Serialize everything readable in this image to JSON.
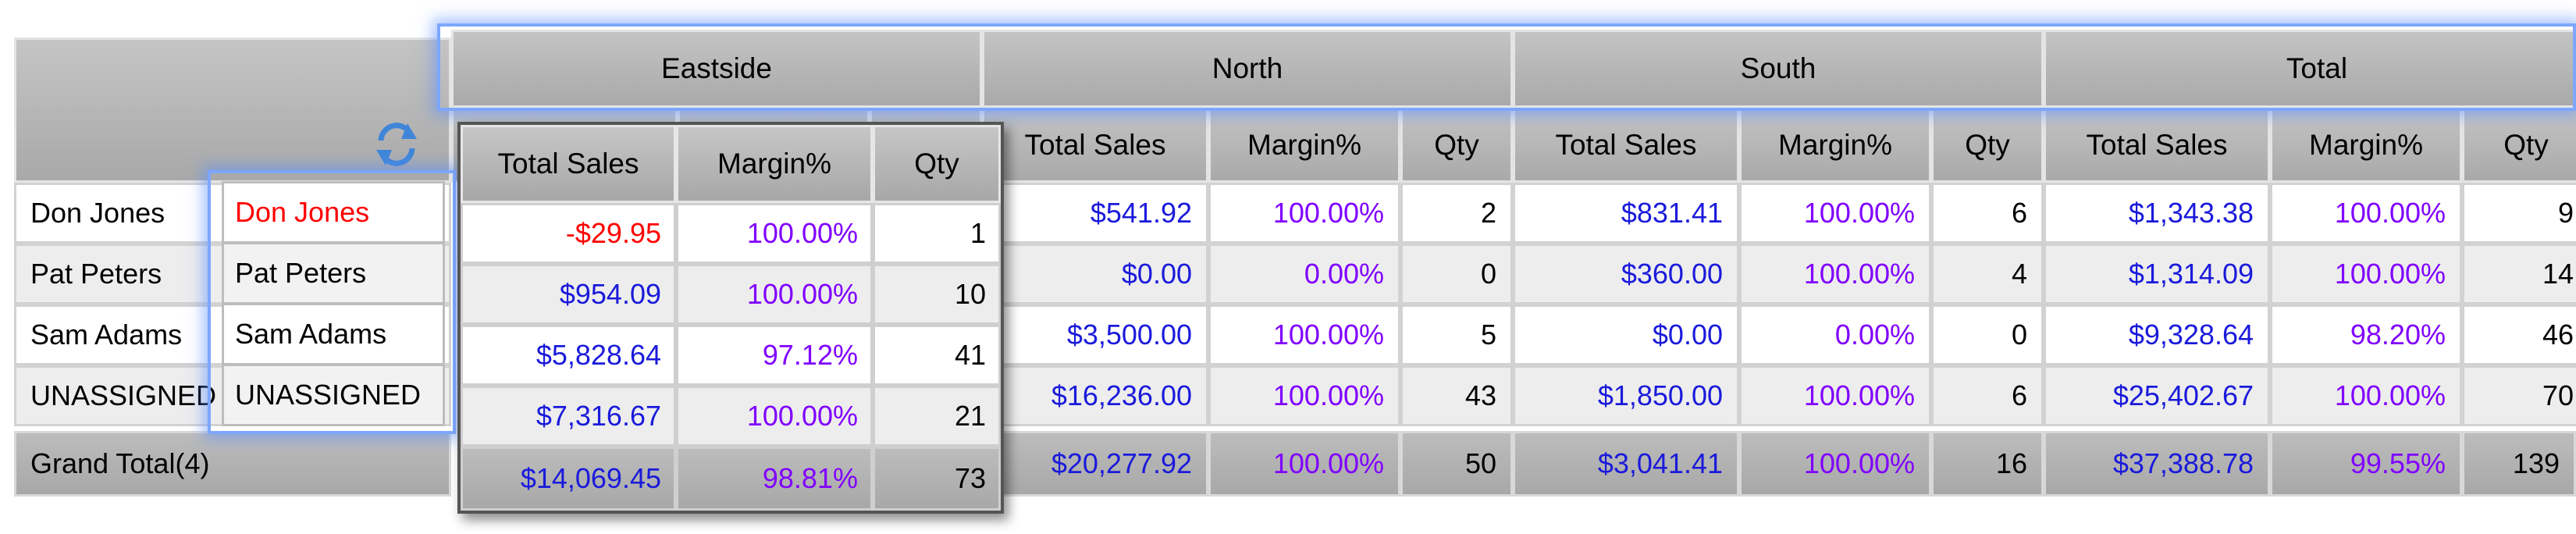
{
  "regions": [
    "Eastside",
    "North",
    "South",
    "Total"
  ],
  "measures": [
    "Total Sales",
    "Margin%",
    "Qty"
  ],
  "rows": [
    {
      "name": "Don Jones",
      "north": {
        "sales": "$541.92",
        "margin": "100.00%",
        "qty": "2"
      },
      "south": {
        "sales": "$831.41",
        "margin": "100.00%",
        "qty": "6"
      },
      "total": {
        "sales": "$1,343.38",
        "margin": "100.00%",
        "qty": "9"
      }
    },
    {
      "name": "Pat Peters",
      "north": {
        "sales": "$0.00",
        "margin": "0.00%",
        "qty": "0"
      },
      "south": {
        "sales": "$360.00",
        "margin": "100.00%",
        "qty": "4"
      },
      "total": {
        "sales": "$1,314.09",
        "margin": "100.00%",
        "qty": "14"
      }
    },
    {
      "name": "Sam Adams",
      "north": {
        "sales": "$3,500.00",
        "margin": "100.00%",
        "qty": "5"
      },
      "south": {
        "sales": "$0.00",
        "margin": "0.00%",
        "qty": "0"
      },
      "total": {
        "sales": "$9,328.64",
        "margin": "98.20%",
        "qty": "46"
      }
    },
    {
      "name": "UNASSIGNED",
      "north": {
        "sales": "$16,236.00",
        "margin": "100.00%",
        "qty": "43"
      },
      "south": {
        "sales": "$1,850.00",
        "margin": "100.00%",
        "qty": "6"
      },
      "total": {
        "sales": "$25,402.67",
        "margin": "100.00%",
        "qty": "70"
      }
    }
  ],
  "grand_total": {
    "label": "Grand Total(4)",
    "north": {
      "sales": "$20,277.92",
      "margin": "100.00%",
      "qty": "50"
    },
    "south": {
      "sales": "$3,041.41",
      "margin": "100.00%",
      "qty": "16"
    },
    "total": {
      "sales": "$37,388.78",
      "margin": "99.55%",
      "qty": "139"
    }
  },
  "eastside_popup": {
    "headers": [
      "Total Sales",
      "Margin%",
      "Qty"
    ],
    "rows": [
      {
        "sales": "-$29.95",
        "margin": "100.00%",
        "qty": "1"
      },
      {
        "sales": "$954.09",
        "margin": "100.00%",
        "qty": "10"
      },
      {
        "sales": "$5,828.64",
        "margin": "97.12%",
        "qty": "41"
      },
      {
        "sales": "$7,316.67",
        "margin": "100.00%",
        "qty": "21"
      },
      {
        "sales": "$14,069.45",
        "margin": "98.81%",
        "qty": "73"
      }
    ]
  },
  "drag_column": [
    "Don Jones",
    "Pat Peters",
    "Sam Adams",
    "UNASSIGNED"
  ],
  "colors": {
    "blue": "#1a1adb",
    "purple": "#8000ff",
    "red": "#ff0000",
    "highlight": "#7da7ff"
  },
  "icons": {
    "refresh": "refresh-icon"
  }
}
